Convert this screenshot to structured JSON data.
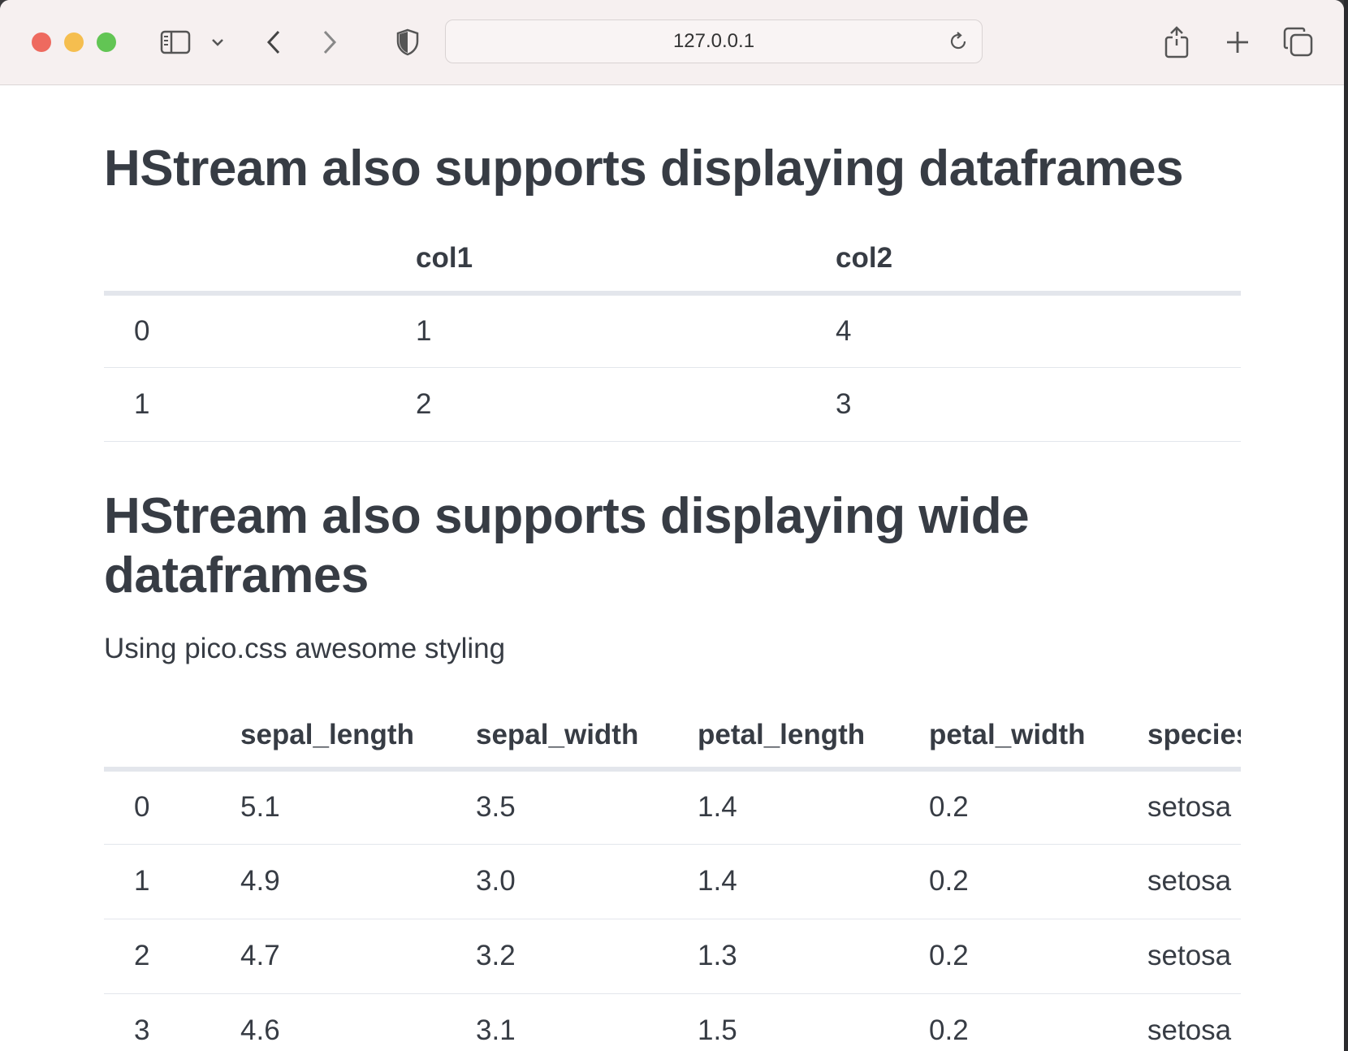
{
  "browser": {
    "url": "127.0.0.1",
    "icons": {
      "sidebar": "sidebar-icon",
      "chevron": "chevron-down-icon",
      "back": "back-icon",
      "forward": "forward-icon",
      "shield": "shield-icon",
      "reload": "reload-icon",
      "share": "share-icon",
      "new_tab": "plus-icon",
      "tabs": "tabs-overview-icon"
    }
  },
  "section1": {
    "heading": "HStream also supports displaying dataframes",
    "table": {
      "headers": [
        "",
        "col1",
        "col2"
      ],
      "rows": [
        [
          "0",
          "1",
          "4"
        ],
        [
          "1",
          "2",
          "3"
        ]
      ]
    }
  },
  "section2": {
    "heading": "HStream also supports displaying wide dataframes",
    "paragraph": "Using pico.css awesome styling",
    "table": {
      "headers": [
        "",
        "sepal_length",
        "sepal_width",
        "petal_length",
        "petal_width",
        "species"
      ],
      "rows": [
        [
          "0",
          "5.1",
          "3.5",
          "1.4",
          "0.2",
          "setosa"
        ],
        [
          "1",
          "4.9",
          "3.0",
          "1.4",
          "0.2",
          "setosa"
        ],
        [
          "2",
          "4.7",
          "3.2",
          "1.3",
          "0.2",
          "setosa"
        ],
        [
          "3",
          "4.6",
          "3.1",
          "1.5",
          "0.2",
          "setosa"
        ]
      ]
    }
  },
  "colors": {
    "text": "#373c44",
    "toolbar": "#f6f0f0",
    "divider": "#e3e6ec"
  }
}
